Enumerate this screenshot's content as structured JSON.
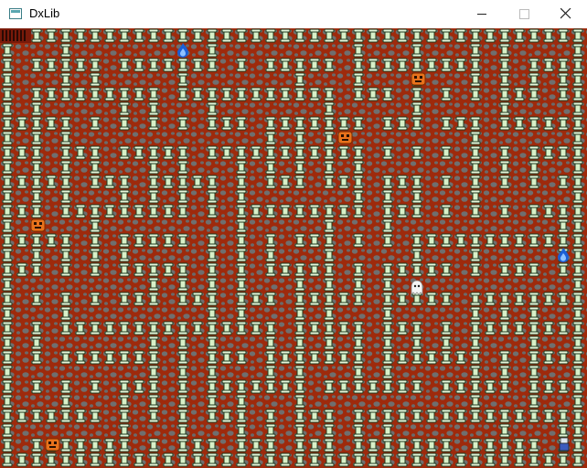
{
  "window": {
    "title": "DxLib",
    "controls": [
      "minimize",
      "maximize",
      "close"
    ]
  },
  "game": {
    "theme": {
      "floor": "#9e2a0c",
      "stone": "#6f6f6f",
      "pillar": "#d8f0c8",
      "pillar_edge": "#1f3a1f",
      "hud": "#7a1a0a"
    },
    "sprites": {
      "ghost": "white-ghost-icon",
      "flame": "blue-flame-icon",
      "monster": "orange-monster-icon",
      "player": "player-icon"
    }
  }
}
